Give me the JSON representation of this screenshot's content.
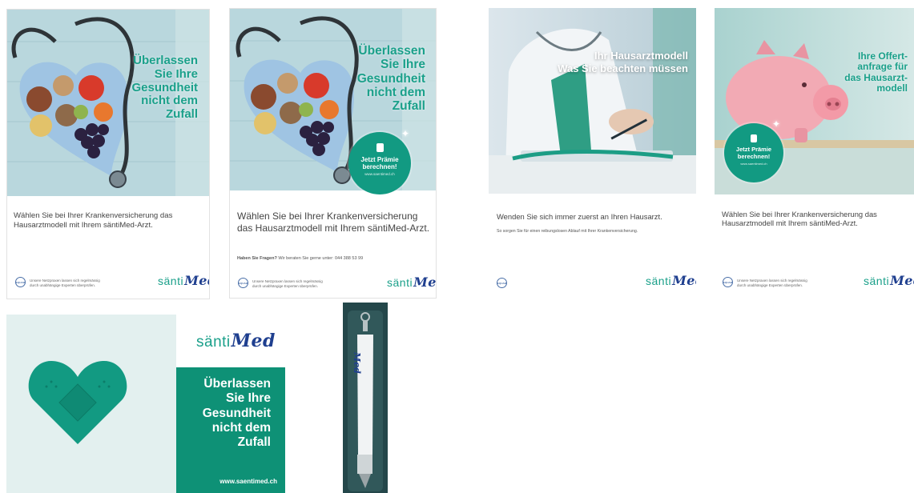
{
  "card1": {
    "headline_lines": [
      "Überlassen",
      "Sie Ihre",
      "Gesundheit",
      "nicht dem",
      "Zufall"
    ],
    "body": "Wählen Sie bei Ihrer Krankenversicherung das Hausarztmodell mit Ihrem säntiMed-Arzt.",
    "equam_badge": "EQUAM",
    "equam_lines": [
      "Unsere Netzpraxen lassen sich regelmässig",
      "durch unabhängige Experten überprüfen."
    ],
    "logo_a": "sänti",
    "logo_b": "Med"
  },
  "card2": {
    "headline_lines": [
      "Überlassen",
      "Sie Ihre",
      "Gesundheit",
      "nicht dem",
      "Zufall"
    ],
    "premium_lines": [
      "Jetzt Prämie",
      "berechnen!"
    ],
    "premium_url": "www.saentimed.ch",
    "body": "Wählen Sie bei Ihrer Krankenversicherung das Hausarztmodell mit Ihrem säntiMed-Arzt.",
    "questions_bold": "Haben Sie Fragen?",
    "questions_rest": " Wir beraten Sie gerne unter: 044 388 53 99",
    "equam_badge": "EQUAM",
    "equam_lines": [
      "Unsere Netzpraxen lassen sich regelmässig",
      "durch unabhängige Experten überprüfen."
    ],
    "logo_a": "sänti",
    "logo_b": "Med"
  },
  "card3": {
    "headline_lines": [
      "Ihr Hausarztmodell",
      "Was Sie beachten müssen"
    ],
    "body": "Wenden Sie sich immer zuerst an Ihren Hausarzt.",
    "sub": "So sorgen Sie für einen reibungslosen Ablauf mit Ihrer Krankenversicherung.",
    "equam_badge": "EQUAM",
    "logo_a": "sänti",
    "logo_b": "Med"
  },
  "card4": {
    "headline_lines": [
      "Ihre Offert-",
      "anfrage für",
      "das Hausarzt-",
      "modell"
    ],
    "premium_lines": [
      "Jetzt Prämie",
      "berechnen!"
    ],
    "premium_url": "www.saentimed.ch",
    "body": "Wählen Sie bei Ihrer Krankenversicherung das Hausarztmodell mit Ihrem säntiMed-Arzt.",
    "equam_badge": "EQUAM",
    "equam_lines": [
      "Unsere Netzpraxen lassen sich regelmässig",
      "durch unabhängige Experten überprüfen."
    ],
    "logo_a": "sänti",
    "logo_b": "Med"
  },
  "card5": {
    "logo_a": "sänti",
    "logo_b": "Med",
    "headline_lines": [
      "Überlassen",
      "Sie Ihre",
      "Gesundheit",
      "nicht dem",
      "Zufall"
    ],
    "url": "www.saentimed.ch"
  },
  "pen": {
    "logo_b": "Med"
  },
  "colors": {
    "brand_green": "#1aa08a",
    "brand_blue": "#1f3f8f",
    "panel_green": "#0e9176"
  }
}
